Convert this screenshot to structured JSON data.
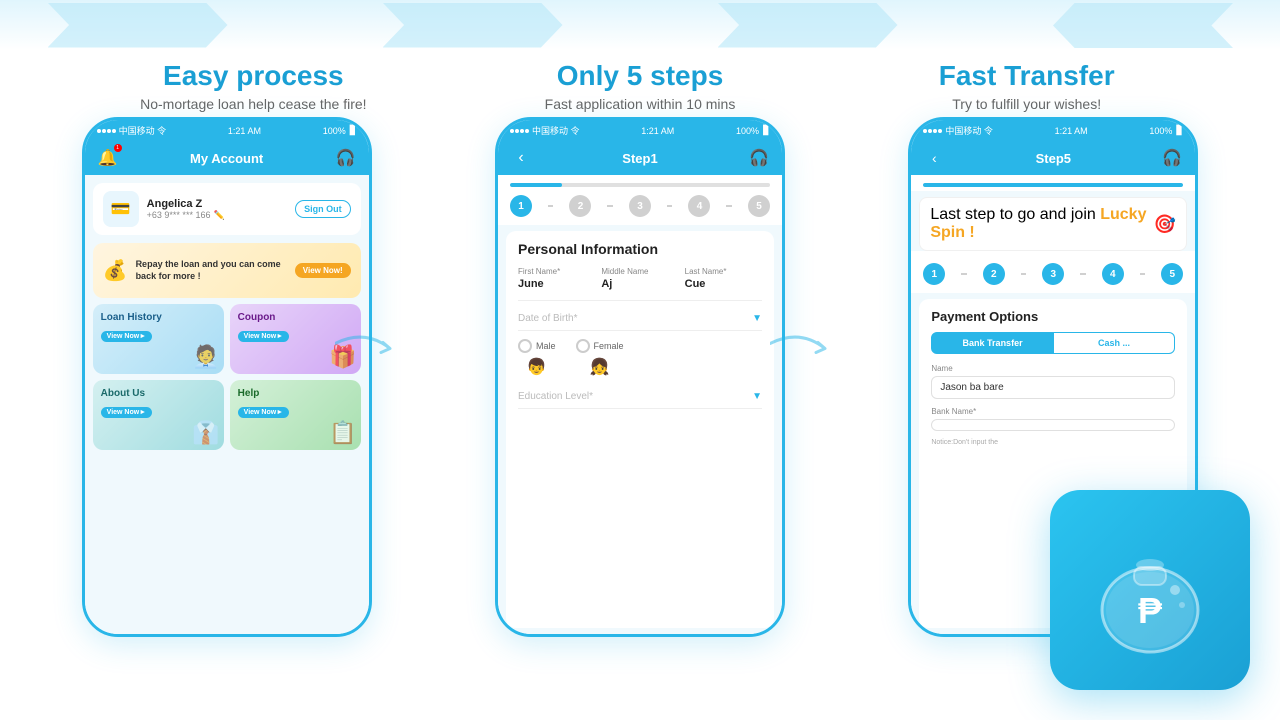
{
  "features": [
    {
      "id": "easy-process",
      "title": "Easy process",
      "subtitle": "No-mortage loan help cease the fire!"
    },
    {
      "id": "only-5-steps",
      "title": "Only 5 steps",
      "subtitle": "Fast application within 10 mins"
    },
    {
      "id": "fast-transfer",
      "title": "Fast Transfer",
      "subtitle": "Try to fulfill your wishes!"
    }
  ],
  "phone1": {
    "statusBar": {
      "carrier": "中国移动 令",
      "time": "1:21 AM",
      "battery": "100%"
    },
    "navTitle": "My Account",
    "profile": {
      "name": "Angelica Z",
      "phone": "+63 9*** *** 166",
      "signOut": "Sign Out"
    },
    "banner": {
      "text": "Repay the loan and you can come back for more !",
      "button": "View Now!"
    },
    "menuCards": [
      {
        "title": "Loan History",
        "button": "View Now►",
        "color": "blue",
        "emoji": "🧑‍💼"
      },
      {
        "title": "Coupon",
        "button": "View Now►",
        "color": "purple",
        "emoji": "🎁"
      },
      {
        "title": "About Us",
        "button": "View Now►",
        "color": "teal",
        "emoji": "👔"
      },
      {
        "title": "Help",
        "button": "View Now►",
        "color": "green",
        "emoji": "📋"
      }
    ]
  },
  "phone2": {
    "statusBar": {
      "carrier": "中国移动 令",
      "time": "1:21 AM",
      "battery": "100%"
    },
    "navTitle": "Step1",
    "progressPercent": 20,
    "steps": [
      1,
      2,
      3,
      4,
      5
    ],
    "activeStep": 1,
    "formTitle": "Personal Information",
    "fields": {
      "firstName": {
        "label": "First Name*",
        "value": "June"
      },
      "middleName": {
        "label": "Middle Name",
        "value": "Aj"
      },
      "lastName": {
        "label": "Last Name*",
        "value": "Cue"
      },
      "dob": {
        "label": "Date of Birth*",
        "placeholder": "Date of Birth*"
      },
      "genders": [
        "Male",
        "Female"
      ],
      "education": {
        "label": "Education Level*",
        "placeholder": "Education Level*"
      }
    }
  },
  "phone3": {
    "statusBar": {
      "carrier": "中国移动 令",
      "time": "1:21 AM",
      "battery": "100%"
    },
    "navTitle": "Step5",
    "progressPercent": 100,
    "steps": [
      1,
      2,
      3,
      4,
      5
    ],
    "activeStep": 5,
    "luckySpinText": "Last step to go and join",
    "luckySpinHighlight": "Lucky Spin !",
    "paymentTitle": "Payment Options",
    "paymentTabs": [
      "Bank Transfer",
      "Cash ..."
    ],
    "activeTab": 0,
    "nameField": {
      "label": "Name",
      "value": "Jason ba bare"
    },
    "bankField": {
      "label": "Bank Name*",
      "value": ""
    },
    "noticeText": "Notice:Don't input the"
  },
  "logo": {
    "emoji": "💰"
  }
}
